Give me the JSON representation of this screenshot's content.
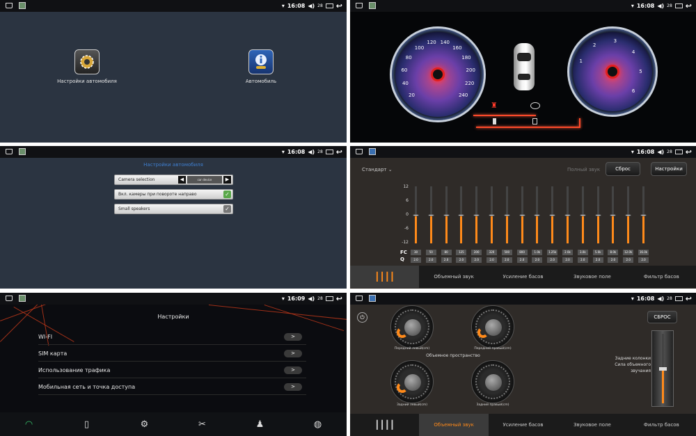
{
  "status": {
    "time_1": "16:08",
    "time_2": "16:08",
    "time_3": "16:08",
    "time_4": "16:08",
    "time_5": "16:09",
    "time_6": "16:08",
    "volume": "28"
  },
  "home": {
    "car_settings_label": "Настройки автомобиля",
    "car_label": "Автомобиль"
  },
  "cluster": {
    "speed_ticks": [
      "20",
      "40",
      "60",
      "80",
      "100",
      "120",
      "140",
      "160",
      "180",
      "200",
      "220",
      "240"
    ],
    "rpm_ticks": [
      "1",
      "2",
      "3",
      "4",
      "5",
      "6"
    ]
  },
  "car_settings": {
    "title": "Настройки автомобиля",
    "camera_label": "Camera selection",
    "camera_value": "car device",
    "right_turn_label": "Вкл. камеры при повороте направо",
    "small_speakers_label": "Small speakers"
  },
  "eq": {
    "preset": "Стандарт",
    "full_sound": "Полный звук",
    "reset": "Сброс",
    "settings": "Настройки",
    "scale": [
      "12",
      "6",
      "0",
      "-6",
      "-12"
    ],
    "fc_label": "FC",
    "q_label": "Q",
    "fc": [
      "30",
      "50",
      "80",
      "125",
      "200",
      "320",
      "500",
      "800",
      "1.0k",
      "1.25k",
      "2.0k",
      "3.0k",
      "5.0k",
      "8.0k",
      "12.0k",
      "16.0k"
    ],
    "q": [
      "2.0",
      "2.0",
      "2.0",
      "2.0",
      "2.0",
      "2.0",
      "2.0",
      "2.0",
      "2.0",
      "2.0",
      "2.0",
      "2.0",
      "2.0",
      "2.0",
      "2.0",
      "2.0"
    ],
    "levels": [
      0,
      0,
      0,
      0,
      0,
      0,
      0,
      0,
      0,
      0,
      0,
      0,
      0,
      0,
      0,
      0
    ]
  },
  "tabs": {
    "surround": "Объемный звук",
    "bass": "Усиление басов",
    "field": "Звуковое поле",
    "filter": "Фильтр басов"
  },
  "settings": {
    "title": "Настройки",
    "items": [
      "WI-FI",
      "SIM карта",
      "Использование трафика",
      "Мобильная сеть и точка доступа"
    ],
    "arrow": ">"
  },
  "surround": {
    "reset": "СБРОС",
    "front_left": "Передний левый(cm)",
    "front_right": "Передний правый(cm)",
    "rear_left": "Задний левый(cm)",
    "rear_right": "Задний правый(cm)",
    "space": "Объемное пространство",
    "rear_speakers": "Задние колонки",
    "surround_power": "Сила объемного звучания"
  },
  "colors": {
    "accent": "#ff8a1a",
    "check": "#5aa84a",
    "blue_title": "#3f7fd0"
  }
}
